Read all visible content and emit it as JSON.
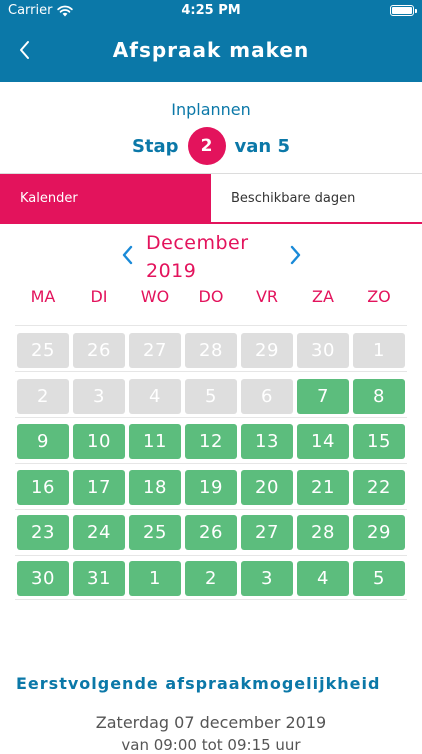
{
  "status_bar": {
    "carrier": "Carrier",
    "time": "4:25 PM"
  },
  "nav": {
    "title": "Afspraak maken"
  },
  "step": {
    "subtitle": "Inplannen",
    "label_prefix": "Stap",
    "current": "2",
    "label_suffix": "van 5"
  },
  "tabs": [
    {
      "label": "Kalender",
      "active": true
    },
    {
      "label": "Beschikbare dagen",
      "active": false
    }
  ],
  "calendar": {
    "month": "December",
    "year": "2019",
    "weekdays": [
      "MA",
      "DI",
      "WO",
      "DO",
      "VR",
      "ZA",
      "ZO"
    ],
    "weeks": [
      [
        {
          "day": "25",
          "available": false
        },
        {
          "day": "26",
          "available": false
        },
        {
          "day": "27",
          "available": false
        },
        {
          "day": "28",
          "available": false
        },
        {
          "day": "29",
          "available": false
        },
        {
          "day": "30",
          "available": false
        },
        {
          "day": "1",
          "available": false
        }
      ],
      [
        {
          "day": "2",
          "available": false
        },
        {
          "day": "3",
          "available": false
        },
        {
          "day": "4",
          "available": false
        },
        {
          "day": "5",
          "available": false
        },
        {
          "day": "6",
          "available": false
        },
        {
          "day": "7",
          "available": true
        },
        {
          "day": "8",
          "available": true
        }
      ],
      [
        {
          "day": "9",
          "available": true
        },
        {
          "day": "10",
          "available": true
        },
        {
          "day": "11",
          "available": true
        },
        {
          "day": "12",
          "available": true
        },
        {
          "day": "13",
          "available": true
        },
        {
          "day": "14",
          "available": true
        },
        {
          "day": "15",
          "available": true
        }
      ],
      [
        {
          "day": "16",
          "available": true
        },
        {
          "day": "17",
          "available": true
        },
        {
          "day": "18",
          "available": true
        },
        {
          "day": "19",
          "available": true
        },
        {
          "day": "20",
          "available": true
        },
        {
          "day": "21",
          "available": true
        },
        {
          "day": "22",
          "available": true
        }
      ],
      [
        {
          "day": "23",
          "available": true
        },
        {
          "day": "24",
          "available": true
        },
        {
          "day": "25",
          "available": true
        },
        {
          "day": "26",
          "available": true
        },
        {
          "day": "27",
          "available": true
        },
        {
          "day": "28",
          "available": true
        },
        {
          "day": "29",
          "available": true
        }
      ],
      [
        {
          "day": "30",
          "available": true
        },
        {
          "day": "31",
          "available": true
        },
        {
          "day": "1",
          "available": true
        },
        {
          "day": "2",
          "available": true
        },
        {
          "day": "3",
          "available": true
        },
        {
          "day": "4",
          "available": true
        },
        {
          "day": "5",
          "available": true
        }
      ]
    ]
  },
  "next_appointment": {
    "heading": "Eerstvolgende afspraakmogelijkheid",
    "date": "Zaterdag 07 december 2019",
    "time": "van 09:00 tot 09:15 uur"
  },
  "colors": {
    "primary": "#0b78a8",
    "accent": "#e3135c",
    "available": "#5cbd7d",
    "unavailable": "#dedede"
  },
  "icons": [
    "wifi-icon",
    "battery-icon",
    "back-chevron-icon",
    "chevron-left-icon",
    "chevron-right-icon"
  ]
}
